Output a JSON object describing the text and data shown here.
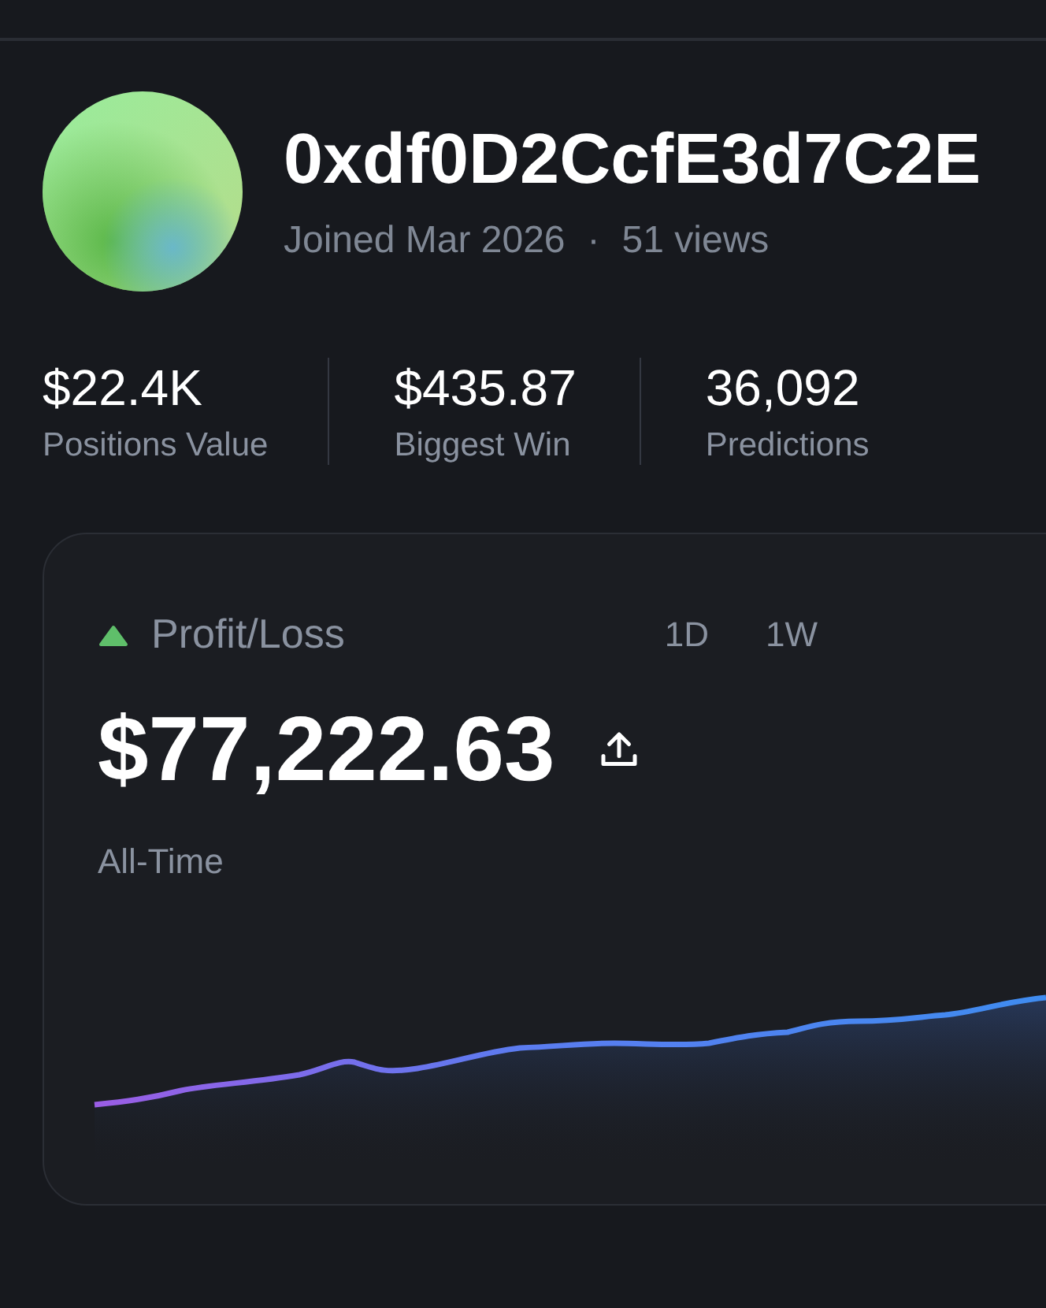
{
  "profile": {
    "address": "0xdf0D2CcfE3d7C2E",
    "joined": "Joined Mar 2026",
    "separator": "·",
    "views": "51 views"
  },
  "stats": [
    {
      "value": "$22.4K",
      "label": "Positions Value"
    },
    {
      "value": "$435.87",
      "label": "Biggest Win"
    },
    {
      "value": "36,092",
      "label": "Predictions"
    }
  ],
  "pnl_card": {
    "title": "Profit/Loss",
    "gain": true,
    "amount": "$77,222.63",
    "period": "All-Time",
    "ranges": [
      {
        "label": "1D",
        "selected": false
      },
      {
        "label": "1W",
        "selected": false
      }
    ]
  }
}
